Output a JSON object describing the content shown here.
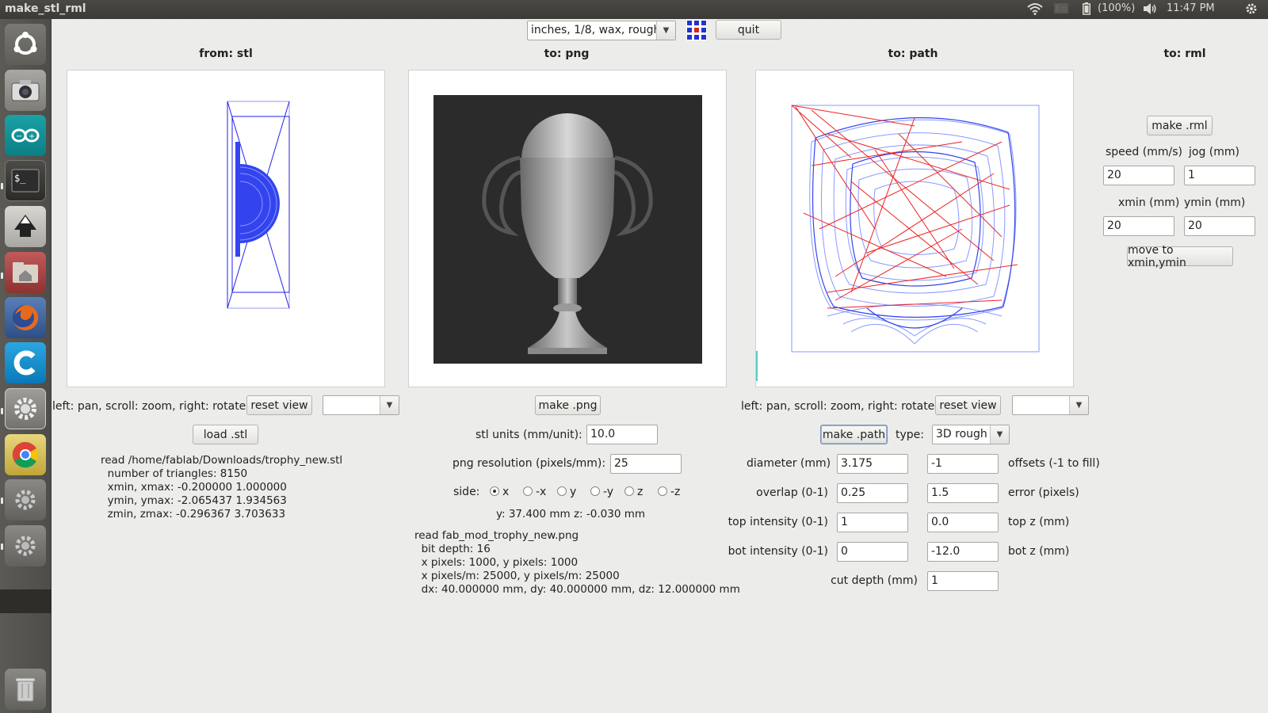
{
  "topbar": {
    "window_title": "make_stl_rml",
    "keyboard": "En",
    "battery": "(100%)",
    "clock": "11:47 PM"
  },
  "launcher": {
    "items": [
      "ubuntu-dash",
      "camera",
      "arduino",
      "terminal",
      "inkscape",
      "home-folder",
      "firefox",
      "cura",
      "system-settings",
      "chrome",
      "settings-2",
      "settings-3",
      "trash"
    ]
  },
  "toolbar": {
    "preset": "inches, 1/8, wax, rough",
    "quit": "quit"
  },
  "stl": {
    "title": "from: stl",
    "hint": "left: pan, scroll: zoom, right: rotate",
    "reset_view": "reset view",
    "view_select": "",
    "load": "load .stl",
    "info": [
      "read /home/fablab/Downloads/trophy_new.stl",
      "  number of triangles: 8150",
      "  xmin, xmax: -0.200000 1.000000",
      "  ymin, ymax: -2.065437 1.934563",
      "  zmin, zmax: -0.296367 3.703633"
    ]
  },
  "png": {
    "title": "to: png",
    "make": "make .png",
    "stl_units_label": "stl units (mm/unit):",
    "stl_units": "10.0",
    "resolution_label": "png resolution (pixels/mm):",
    "resolution": "25",
    "side_label": "side:",
    "sides": [
      "x",
      "-x",
      "y",
      "-y",
      "z",
      "-z"
    ],
    "side_selected": "x",
    "yz": "y: 37.400 mm  z: -0.030 mm",
    "info": [
      "read fab_mod_trophy_new.png",
      "  bit depth: 16",
      "  x pixels: 1000, y pixels: 1000",
      "  x pixels/m: 25000, y pixels/m: 25000",
      "  dx: 40.000000 mm, dy: 40.000000 mm, dz: 12.000000 mm"
    ]
  },
  "path": {
    "title": "to: path",
    "hint": "left: pan, scroll: zoom, right: rotate",
    "reset_view": "reset view",
    "view_select": "",
    "make": "make .path",
    "type_label": "type:",
    "type": "3D rough",
    "diameter_label": "diameter (mm)",
    "diameter": "3.175",
    "offsets": "-1",
    "offsets_label": "offsets (-1 to fill)",
    "overlap_label": "overlap (0-1)",
    "overlap": "0.25",
    "error": "1.5",
    "error_label": "error (pixels)",
    "top_intensity_label": "top intensity (0-1)",
    "top_intensity": "1",
    "top_z": "0.0",
    "top_z_label": "top z (mm)",
    "bot_intensity_label": "bot intensity (0-1)",
    "bot_intensity": "0",
    "bot_z": "-12.0",
    "bot_z_label": "bot z (mm)",
    "cut_depth_label": "cut depth (mm)",
    "cut_depth": "1"
  },
  "rml": {
    "title": "to: rml",
    "make": "make .rml",
    "speed_label": "speed (mm/s)",
    "speed": "20",
    "jog_label": "jog (mm)",
    "jog": "1",
    "xmin_label": "xmin (mm)",
    "xmin": "20",
    "ymin_label": "ymin (mm)",
    "ymin": "20",
    "move": "move to xmin,ymin"
  },
  "colors": {
    "panel_bg": "#ececea",
    "launcher": "#4e4d49",
    "mesh_blue": "#2222ee",
    "path_red": "#ee2222",
    "path_blue": "#3344ee",
    "png_bg": "#2b2b2b"
  }
}
